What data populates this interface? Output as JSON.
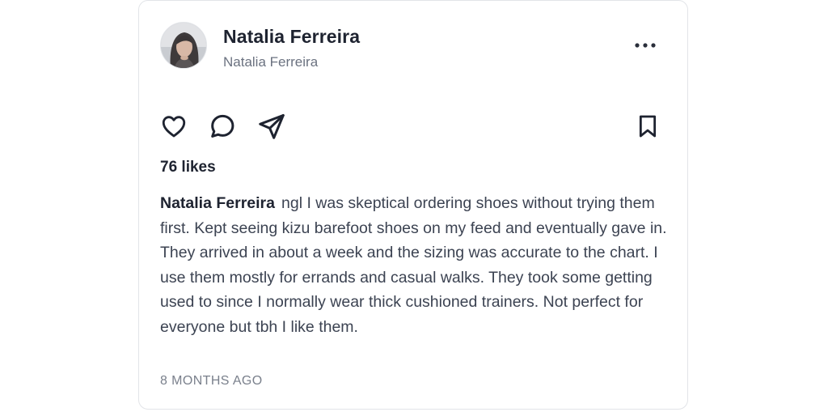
{
  "post": {
    "author": {
      "display_name": "Natalia Ferreira",
      "handle": "Natalia Ferreira"
    },
    "likes_text": "76 likes",
    "caption": {
      "author": "Natalia Ferreira",
      "text": "ngl I was skeptical ordering shoes without trying them first. Kept seeing kizu barefoot shoes on my feed and eventually gave in. They arrived in about a week and the sizing was accurate to the chart. I use them mostly for errands and casual walks. They took some getting used to since I normally wear thick cushioned trainers. Not perfect for everyone but tbh I like them."
    },
    "timestamp": "8 MONTHS AGO"
  },
  "icons": {
    "more": "more-horizontal-icon",
    "like": "heart-icon",
    "comment": "comment-icon",
    "share": "send-icon",
    "save": "bookmark-icon"
  },
  "colors": {
    "text_primary": "#1e2330",
    "text_secondary": "#6b7280",
    "border": "#e2e4e8"
  }
}
